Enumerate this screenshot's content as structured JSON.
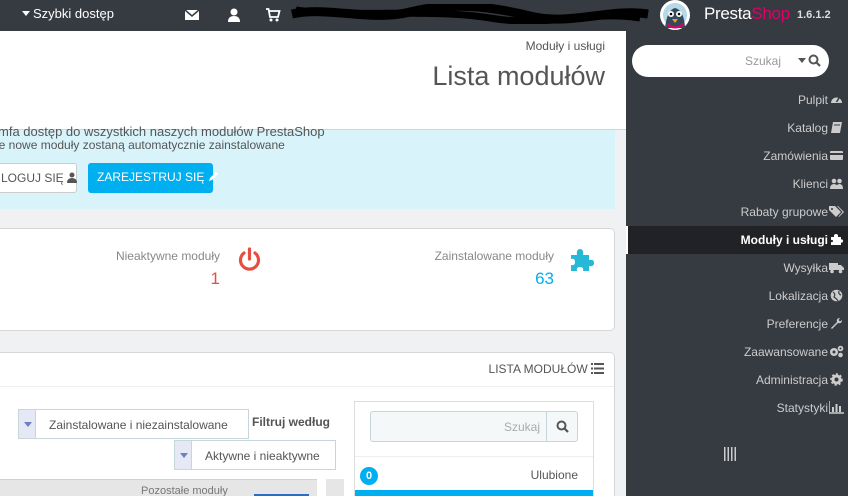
{
  "topbar": {
    "quick_access": "Szybki dostęp",
    "icons": [
      "envelope-icon",
      "user-icon",
      "cart-icon"
    ],
    "brand_presta": "Presta",
    "brand_shop": "Shop",
    "version": "1.6.1.2"
  },
  "header": {
    "breadcrumb": "Moduły i usługi",
    "title": "Lista modułów"
  },
  "alert": {
    "line1": "mfa dostęp do wszystkich naszych modułów PrestaShop",
    "line2": "je nowe moduły zostaną automatycznie zainstalowane",
    "login_button": "LOGUJ SIĘ",
    "register_button": "ZAREJESTRUJ SIĘ"
  },
  "stats": {
    "inactive_label": "Nieaktywne moduły",
    "inactive_value": "1",
    "installed_label": "Zainstalowane moduły",
    "installed_value": "63"
  },
  "modules_panel": {
    "title": "LISTA MODUŁÓW",
    "filter_label": "Filtruj według",
    "select_install": "Zainstalowane i niezainstalowane",
    "select_active": "Aktywne i nieaktywne",
    "remaining": "Pozostałe moduły",
    "search_placeholder": "Szukaj",
    "favorites_count": "0",
    "favorites_label": "Ulubione"
  },
  "sidebar": {
    "search_placeholder": "Szukaj",
    "items": [
      {
        "label": "Pulpit",
        "icon": "dashboard-icon"
      },
      {
        "label": "Katalog",
        "icon": "book-icon"
      },
      {
        "label": "Zamówienia",
        "icon": "credit-card-icon"
      },
      {
        "label": "Klienci",
        "icon": "users-icon"
      },
      {
        "label": "Rabaty grupowe",
        "icon": "tags-icon"
      },
      {
        "label": "Moduły i usługi",
        "icon": "puzzle-icon"
      },
      {
        "label": "Wysyłka",
        "icon": "truck-icon"
      },
      {
        "label": "Lokalizacja",
        "icon": "globe-icon"
      },
      {
        "label": "Preferencje",
        "icon": "wrench-icon"
      },
      {
        "label": "Zaawansowane",
        "icon": "cogs-icon"
      },
      {
        "label": "Administracja",
        "icon": "cog-icon"
      },
      {
        "label": "Statystyki",
        "icon": "bar-chart-icon"
      }
    ]
  },
  "colors": {
    "accent": "#00aff0",
    "inactive_red": "#e84e40",
    "sidebar_bg": "#363a41",
    "brand_pink": "#df0067"
  }
}
